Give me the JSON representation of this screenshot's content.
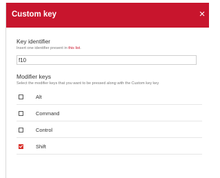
{
  "dialog": {
    "title": "Custom key",
    "close_glyph": "×",
    "accent": "#c8152d"
  },
  "key_identifier": {
    "title": "Key identifier",
    "subtitle_prefix": "Insert one identifier present in ",
    "link_text": "this list",
    "subtitle_suffix": ".",
    "value": "f10"
  },
  "modifier_keys": {
    "title": "Modifier keys",
    "subtitle": "Select the modifier keys that you want to be pressed along with the Custom key key",
    "items": [
      {
        "label": "Alt",
        "checked": false
      },
      {
        "label": "Command",
        "checked": false
      },
      {
        "label": "Control",
        "checked": false
      },
      {
        "label": "Shift",
        "checked": true
      }
    ]
  }
}
